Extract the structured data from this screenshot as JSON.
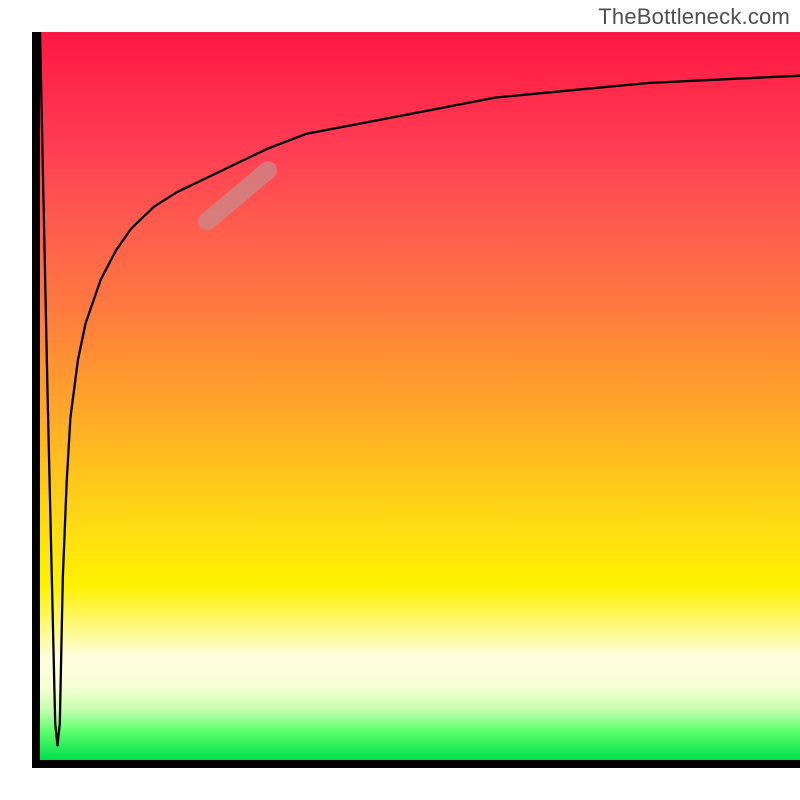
{
  "watermark": "TheBottleneck.com",
  "chart_data": {
    "type": "line",
    "title": "",
    "xlabel": "",
    "ylabel": "",
    "xlim": [
      0,
      100
    ],
    "ylim": [
      0,
      100
    ],
    "grid": false,
    "legend": false,
    "annotations": [
      {
        "name": "highlight-marker",
        "x_range": [
          22,
          30
        ],
        "y_range": [
          74,
          81
        ]
      }
    ],
    "series": [
      {
        "name": "bottleneck-curve",
        "x": [
          0,
          1,
          2,
          2.3,
          2.6,
          2.8,
          3,
          3.5,
          4,
          5,
          6,
          8,
          10,
          12,
          15,
          18,
          22,
          26,
          30,
          35,
          40,
          45,
          50,
          55,
          60,
          70,
          80,
          90,
          100
        ],
        "y": [
          100,
          50,
          5,
          2,
          5,
          15,
          25,
          38,
          47,
          55,
          60,
          66,
          70,
          73,
          76,
          78,
          80,
          82,
          84,
          86,
          87,
          88,
          89,
          90,
          91,
          92,
          93,
          93.5,
          94
        ]
      }
    ],
    "background_gradient": {
      "direction": "vertical",
      "stops": [
        {
          "pos": 0.0,
          "color": "#ff1744"
        },
        {
          "pos": 0.38,
          "color": "#ff7a3f"
        },
        {
          "pos": 0.68,
          "color": "#ffdc14"
        },
        {
          "pos": 0.86,
          "color": "#fffde0"
        },
        {
          "pos": 1.0,
          "color": "#00e04c"
        }
      ]
    }
  }
}
